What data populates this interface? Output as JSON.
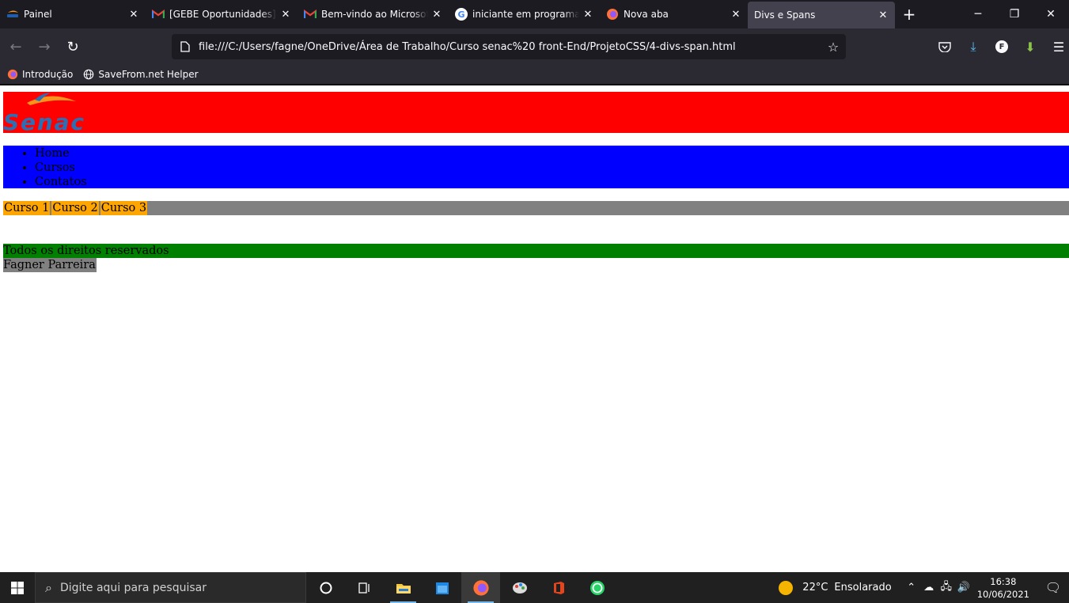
{
  "browser": {
    "tabs": [
      {
        "title": "Painel",
        "icon": "senac-favicon"
      },
      {
        "title": "[GEBE Oportunidades] Ass",
        "icon": "gmail-icon"
      },
      {
        "title": "Bem-vindo ao Microsoft Te",
        "icon": "gmail-icon"
      },
      {
        "title": "iniciante em programação",
        "icon": "google-icon"
      },
      {
        "title": "Nova aba",
        "icon": "firefox-icon"
      },
      {
        "title": "Divs e Spans",
        "icon": "none",
        "active": true
      }
    ],
    "url": "file:///C:/Users/fagne/OneDrive/Área de Trabalho/Curso senac%20 front-End/ProjetoCSS/4-divs-span.html",
    "bookmarks": [
      {
        "label": "Introdução",
        "icon": "firefox-icon"
      },
      {
        "label": "SaveFrom.net Helper",
        "icon": "globe-icon"
      }
    ],
    "profile_initial": "F"
  },
  "page": {
    "logo_text": "Senac",
    "nav_items": [
      "Home",
      "Cursos",
      "Contatos"
    ],
    "courses": [
      "Curso 1",
      "Curso 2",
      "Curso 3"
    ],
    "footer_text": "Todos os direitos reservados",
    "author": "Fagner Parreira",
    "colors": {
      "header": "#ff0000",
      "nav": "#0000ff",
      "courses_bar": "#808080",
      "course_item": "#ffa500",
      "footer": "#008000",
      "author_bg": "#808080"
    }
  },
  "taskbar": {
    "search_placeholder": "Digite aqui para pesquisar",
    "weather_temp": "22°C",
    "weather_desc": "Ensolarado",
    "time": "16:38",
    "date": "10/06/2021"
  }
}
